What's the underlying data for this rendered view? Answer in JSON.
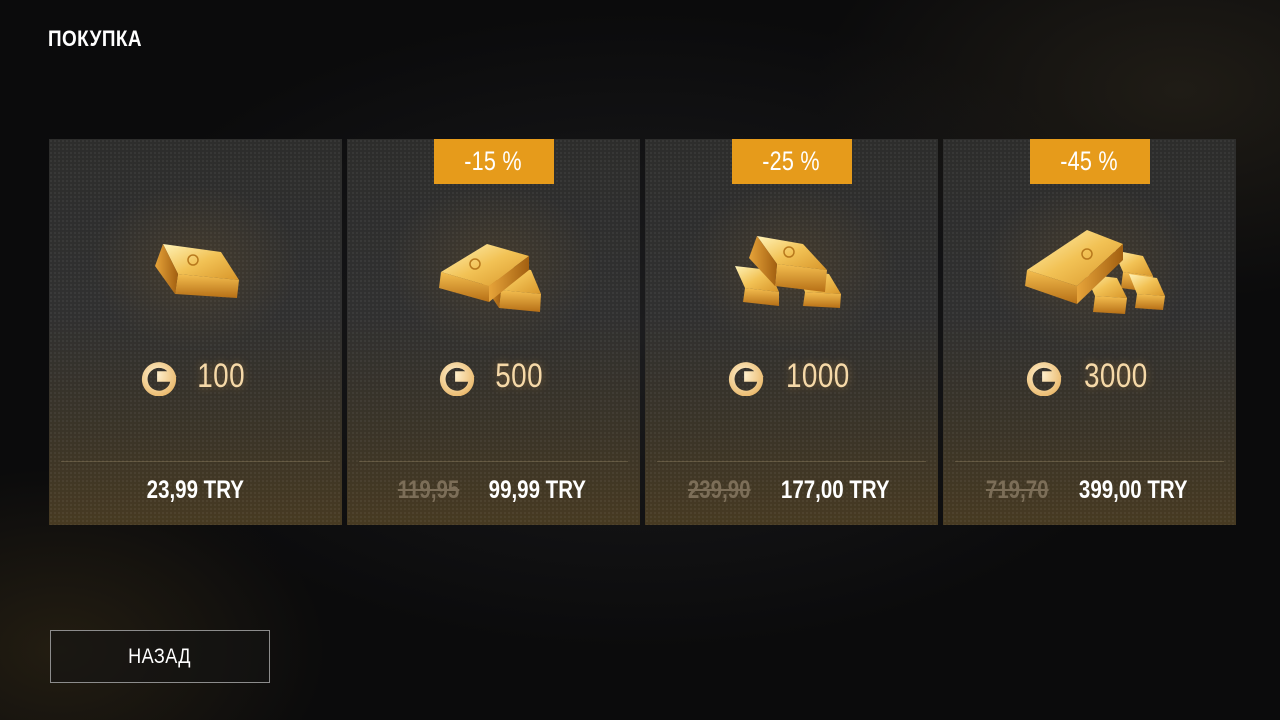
{
  "header": {
    "title": "ПОКУПКА"
  },
  "currency_icon": "gold-g-icon",
  "accent_color": "#e69b1b",
  "offers": [
    {
      "amount": "100",
      "price": "23,99 TRY",
      "old_price": "",
      "discount": ""
    },
    {
      "amount": "500",
      "price": "99,99 TRY",
      "old_price": "119,95",
      "discount": "-15 %"
    },
    {
      "amount": "1000",
      "price": "177,00 TRY",
      "old_price": "239,90",
      "discount": "-25 %"
    },
    {
      "amount": "3000",
      "price": "399,00 TRY",
      "old_price": "719,70",
      "discount": "-45 %"
    }
  ],
  "footer": {
    "back_label": "НАЗАД"
  }
}
